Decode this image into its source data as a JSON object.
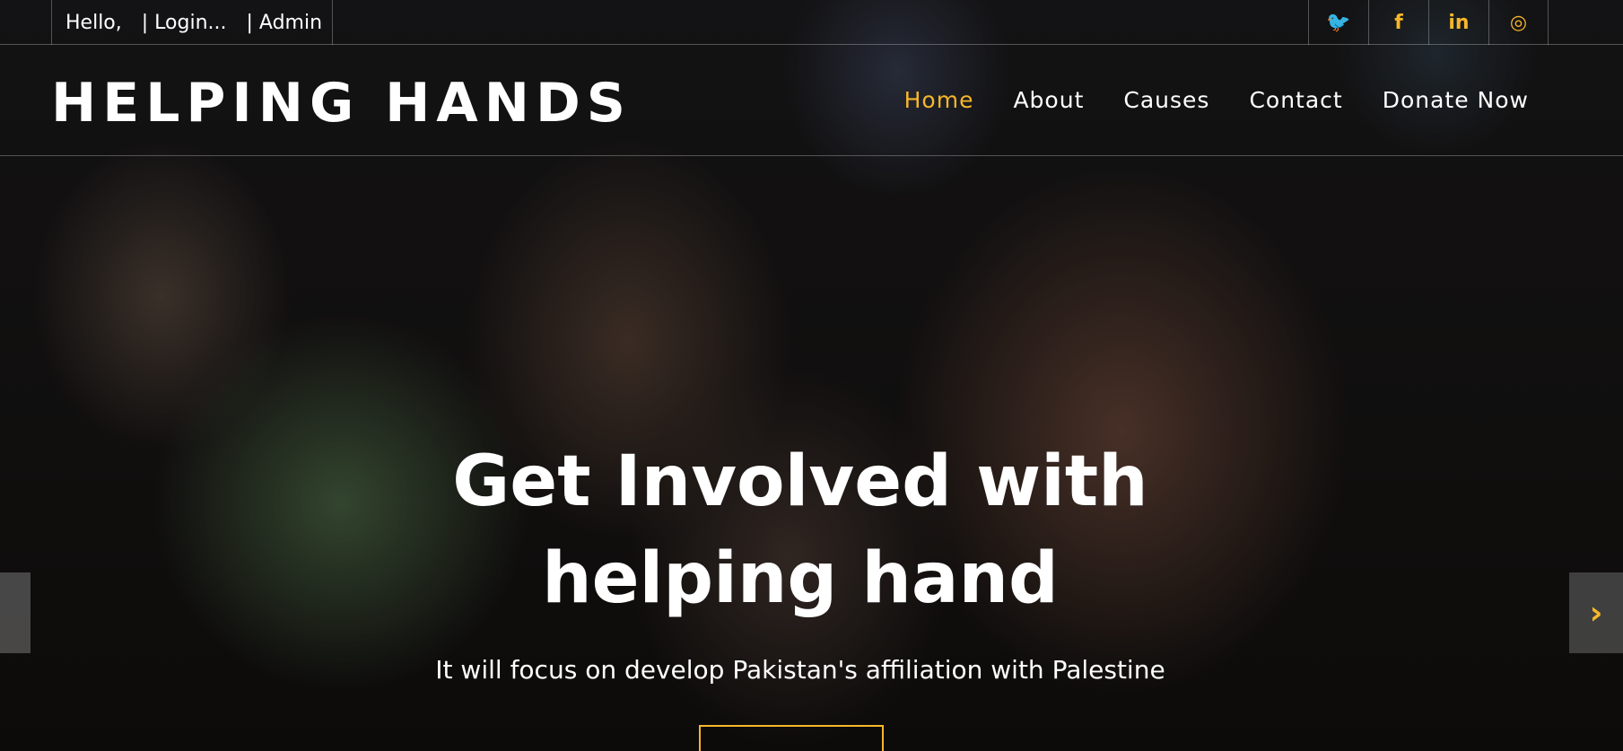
{
  "topbar": {
    "hello": "Hello,",
    "login": "| Login...",
    "admin": "| Admin",
    "social": [
      {
        "icon": "twitter-icon",
        "glyph": "🐦"
      },
      {
        "icon": "facebook-icon",
        "glyph": "f"
      },
      {
        "icon": "linkedin-icon",
        "glyph": "in"
      },
      {
        "icon": "instagram-icon",
        "glyph": "◎"
      }
    ]
  },
  "navbar": {
    "logo": "HELPING HANDS",
    "links": [
      "Home",
      "About",
      "Causes",
      "Contact",
      "Donate Now"
    ],
    "active": "Home"
  },
  "hero": {
    "title_line1": "Get Involved with",
    "title_line2": "helping hand",
    "subtitle": "It will focus on develop Pakistan's affiliation with Palestine",
    "next_glyph": "›"
  },
  "colors": {
    "accent": "#f7b72a",
    "text": "#ffffff"
  }
}
